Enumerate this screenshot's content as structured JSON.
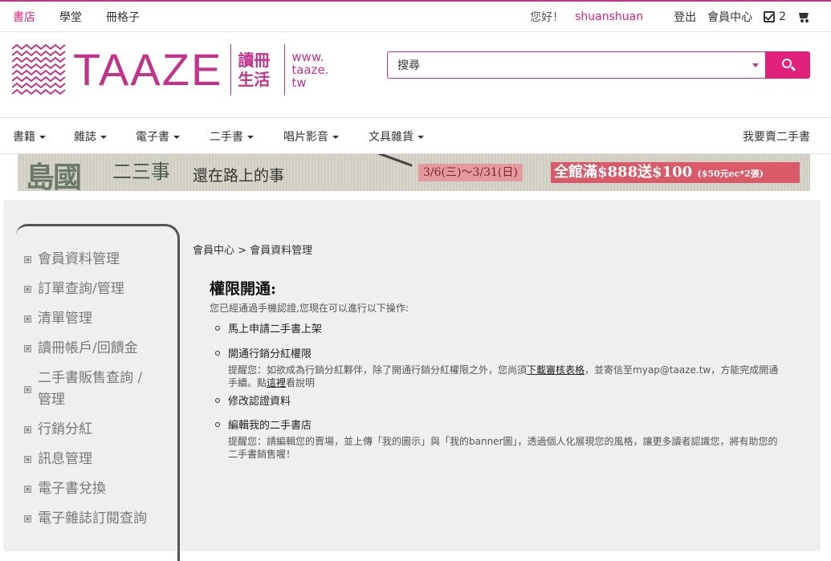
{
  "topbar": {
    "links": [
      "書店",
      "學堂",
      "冊格子"
    ],
    "greeting": "您好！",
    "username": "shuanshuan",
    "logout": "登出",
    "member_center": "會員中心",
    "check_count": "2"
  },
  "logo": {
    "text": "TAAZE",
    "cn_line1": "讀冊",
    "cn_line2": "生活",
    "url_line1": "www.",
    "url_line2": "taaze.",
    "url_line3": "tw"
  },
  "search": {
    "value": "搜尋"
  },
  "nav": {
    "items": [
      "書籍",
      "雜誌",
      "電子書",
      "二手書",
      "唱片影音",
      "文具雜貨"
    ],
    "sell": "我要賣二手書"
  },
  "banner": {
    "title_big": "島國",
    "title_mid": "二三事",
    "title_sub": "還在路上的事",
    "date": "3/6(三)～3/31(日)",
    "promo": "全館滿$888送$100",
    "promo_small": "($50元ec*2張)"
  },
  "sidebar": {
    "items": [
      "會員資料管理",
      "訂單查詢/管理",
      "清單管理",
      "讀冊帳戶/回饋金",
      "二手書販售查詢 /",
      "管理",
      "行銷分紅",
      "訊息管理",
      "電子書兌換",
      "電子雜誌訂閱查詢"
    ]
  },
  "main": {
    "breadcrumb": "會員中心 > 會員資料管理",
    "heading": "權限開通:",
    "intro": "您已經通過手機認證,您現在可以進行以下操作:",
    "options": [
      "馬上申請二手書上架",
      "開通行銷分紅權限",
      "修改認證資料",
      "編輯我的二手書店"
    ],
    "note1_a": "提醒您：如欲成為行銷分紅夥伴，除了開通行銷分紅權限之外，您尚須",
    "note1_link": "下載審核表格",
    "note1_b": "，並寄信至myap@taaze.tw，方能完成開通手續。點",
    "note1_link2": "這裡",
    "note1_c": "看說明",
    "note2": "提醒您：請編輯您的賣場，並上傳「我的圖示」與「我的banner圖」，透過個人化展現您的風格，讓更多讀者認識您，將有助您的二手書銷售喔！"
  },
  "colors": {
    "brand": "#e0217b",
    "logo": "#c0348c"
  }
}
